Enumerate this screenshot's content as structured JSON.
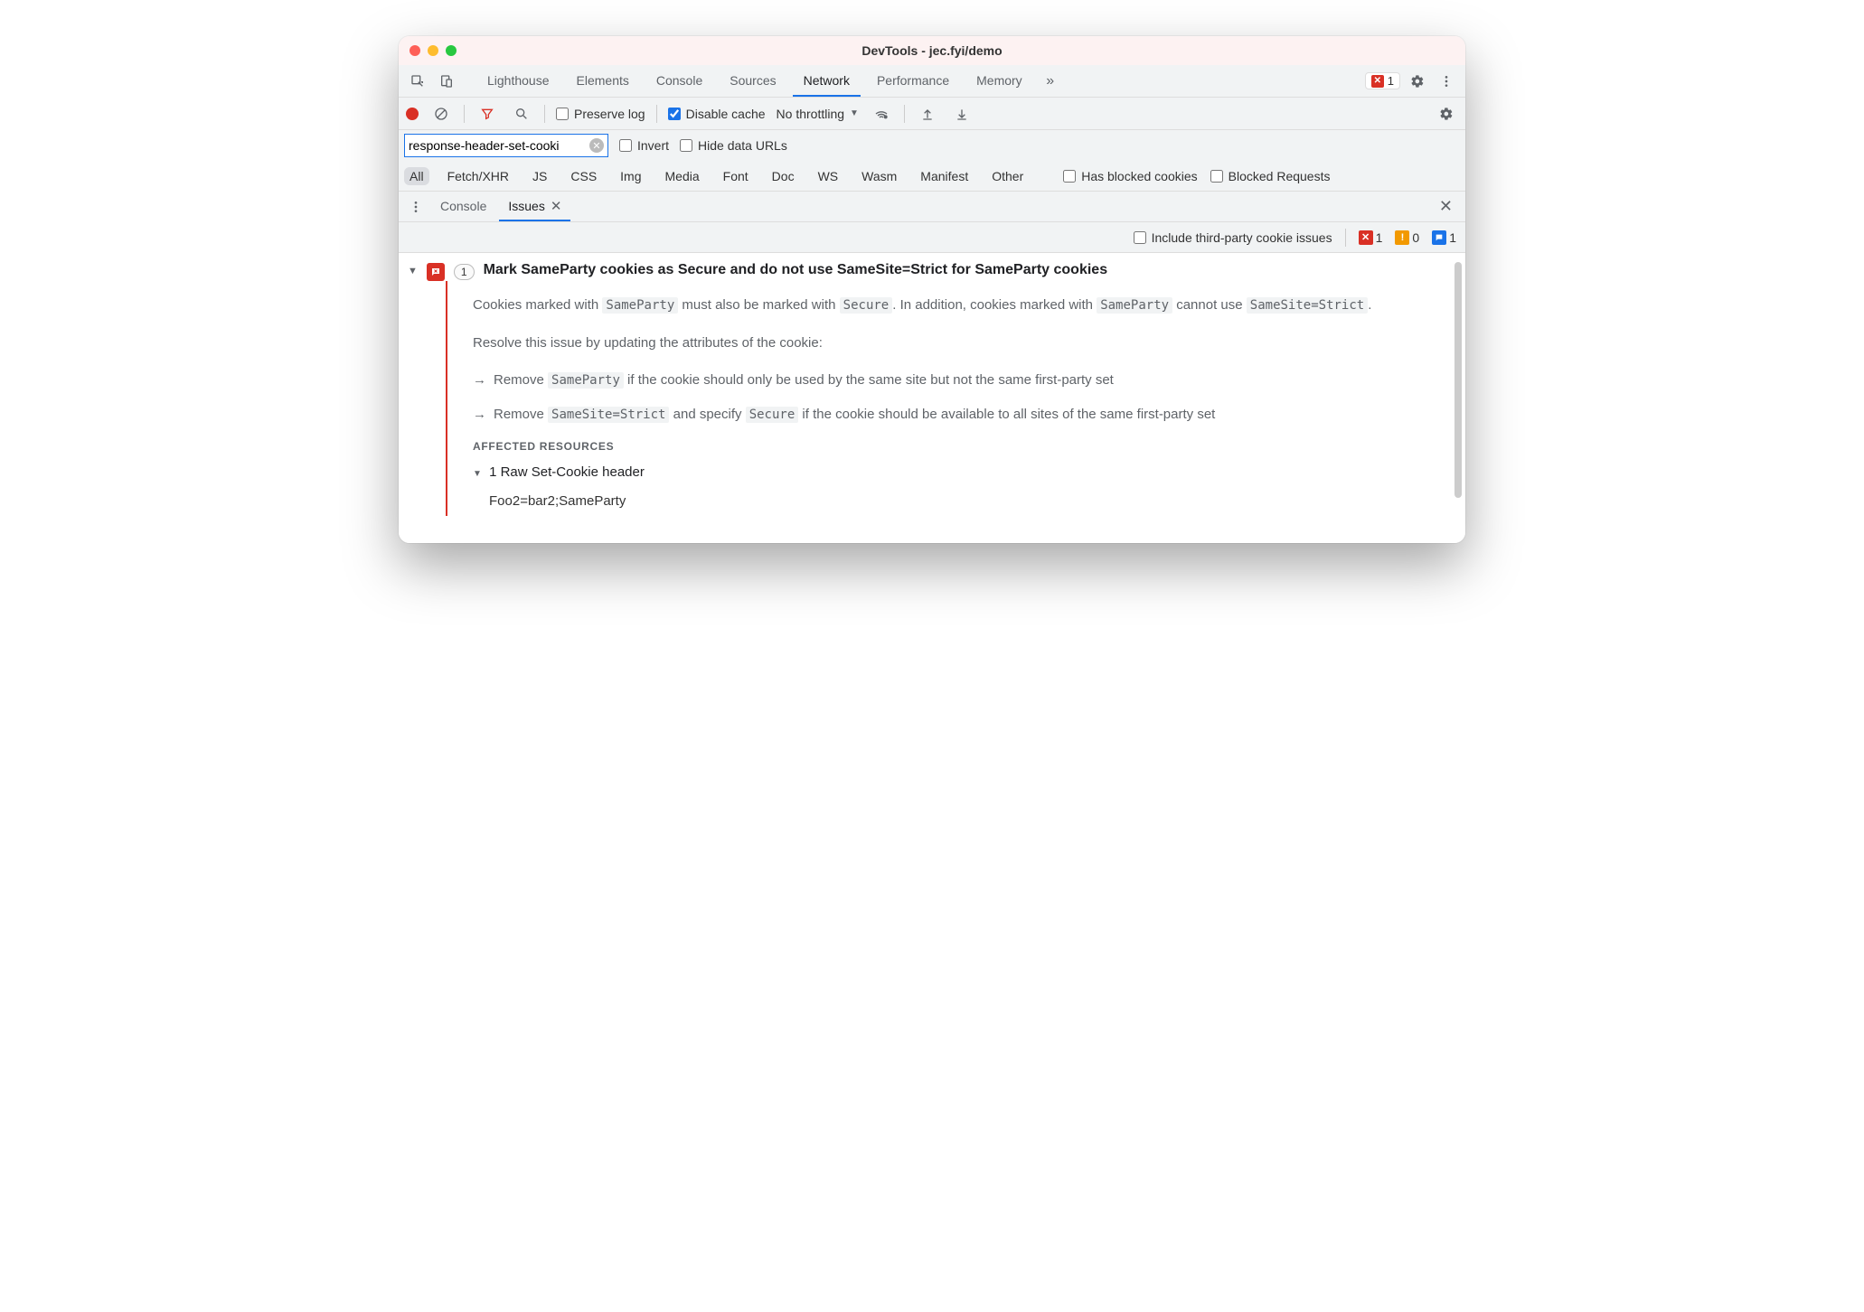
{
  "window": {
    "title": "DevTools - jec.fyi/demo"
  },
  "main_tabs": {
    "items": [
      "Lighthouse",
      "Elements",
      "Console",
      "Sources",
      "Network",
      "Performance",
      "Memory"
    ],
    "active": "Network",
    "overflow_glyph": "»",
    "error_count": "1"
  },
  "net_toolbar": {
    "preserve_log": "Preserve log",
    "disable_cache": "Disable cache",
    "throttling": "No throttling"
  },
  "filter": {
    "value": "response-header-set-cooki",
    "invert": "Invert",
    "hide_data_urls": "Hide data URLs"
  },
  "type_filters": {
    "items": [
      "All",
      "Fetch/XHR",
      "JS",
      "CSS",
      "Img",
      "Media",
      "Font",
      "Doc",
      "WS",
      "Wasm",
      "Manifest",
      "Other"
    ],
    "active": "All",
    "has_blocked_cookies": "Has blocked cookies",
    "blocked_requests": "Blocked Requests"
  },
  "drawer": {
    "tabs": [
      "Console",
      "Issues"
    ],
    "active": "Issues",
    "include_third": "Include third-party cookie issues",
    "sev_error": "1",
    "sev_warn": "0",
    "sev_info": "1"
  },
  "issue": {
    "count": "1",
    "title": "Mark SameParty cookies as Secure and do not use SameSite=Strict for SameParty cookies",
    "p1_a": "Cookies marked with ",
    "p1_c1": "SameParty",
    "p1_b": " must also be marked with ",
    "p1_c2": "Secure",
    "p1_c": ". In addition, cookies marked with ",
    "p1_c3": "SameParty",
    "p1_d": " cannot use ",
    "p1_c4": "SameSite=Strict",
    "p1_e": ".",
    "p2": "Resolve this issue by updating the attributes of the cookie:",
    "b1_a": "Remove ",
    "b1_c": "SameParty",
    "b1_b": " if the cookie should only be used by the same site but not the same first-party set",
    "b2_a": "Remove ",
    "b2_c1": "SameSite=Strict",
    "b2_b": " and specify ",
    "b2_c2": "Secure",
    "b2_c": " if the cookie should be available to all sites of the same first-party set",
    "affected_head": "AFFECTED RESOURCES",
    "res_title": "1 Raw Set-Cookie header",
    "res_item": "Foo2=bar2;SameParty"
  }
}
